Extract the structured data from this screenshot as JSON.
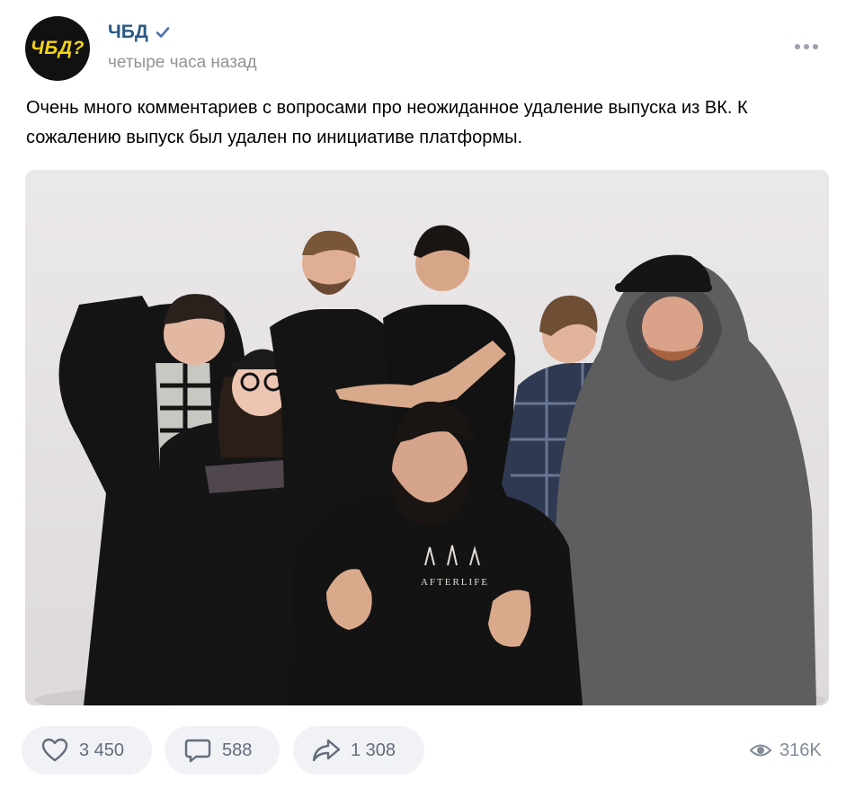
{
  "post": {
    "author": {
      "name": "ЧБД",
      "avatar_text": "ЧБД?",
      "verified": true
    },
    "timestamp": "четыре часа назад",
    "text": "Очень много комментариев с вопросами про неожиданное удаление выпуска из ВК. К сожалению выпуск был удален по инициативе платформы.",
    "photo": {
      "shirt_print": "AFTERLIFE"
    }
  },
  "actions": {
    "likes": "3 450",
    "comments": "588",
    "shares": "1 308",
    "views": "316K"
  },
  "colors": {
    "link": "#2a5885",
    "secondary_text": "#939393",
    "action_bg": "#f0f2f5",
    "action_text": "#626d7a",
    "avatar_bg": "#111111",
    "avatar_text": "#f2d31b"
  },
  "icons": [
    "verified-icon",
    "more-icon",
    "like-icon",
    "comment-icon",
    "share-icon",
    "views-icon"
  ]
}
